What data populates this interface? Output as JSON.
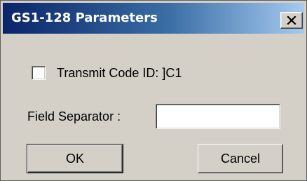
{
  "window": {
    "title": "GS1-128 Parameters",
    "close_icon": "close-icon"
  },
  "options": {
    "transmit_code_id": {
      "label": "Transmit Code ID: ]C1",
      "checked": false
    }
  },
  "field_separator": {
    "label": "Field Separator :",
    "value": ""
  },
  "buttons": {
    "ok_label": "OK",
    "cancel_label": "Cancel"
  },
  "colors": {
    "face": "#d4d0c8",
    "title_start": "#0a246a",
    "title_end": "#a6caf0"
  }
}
